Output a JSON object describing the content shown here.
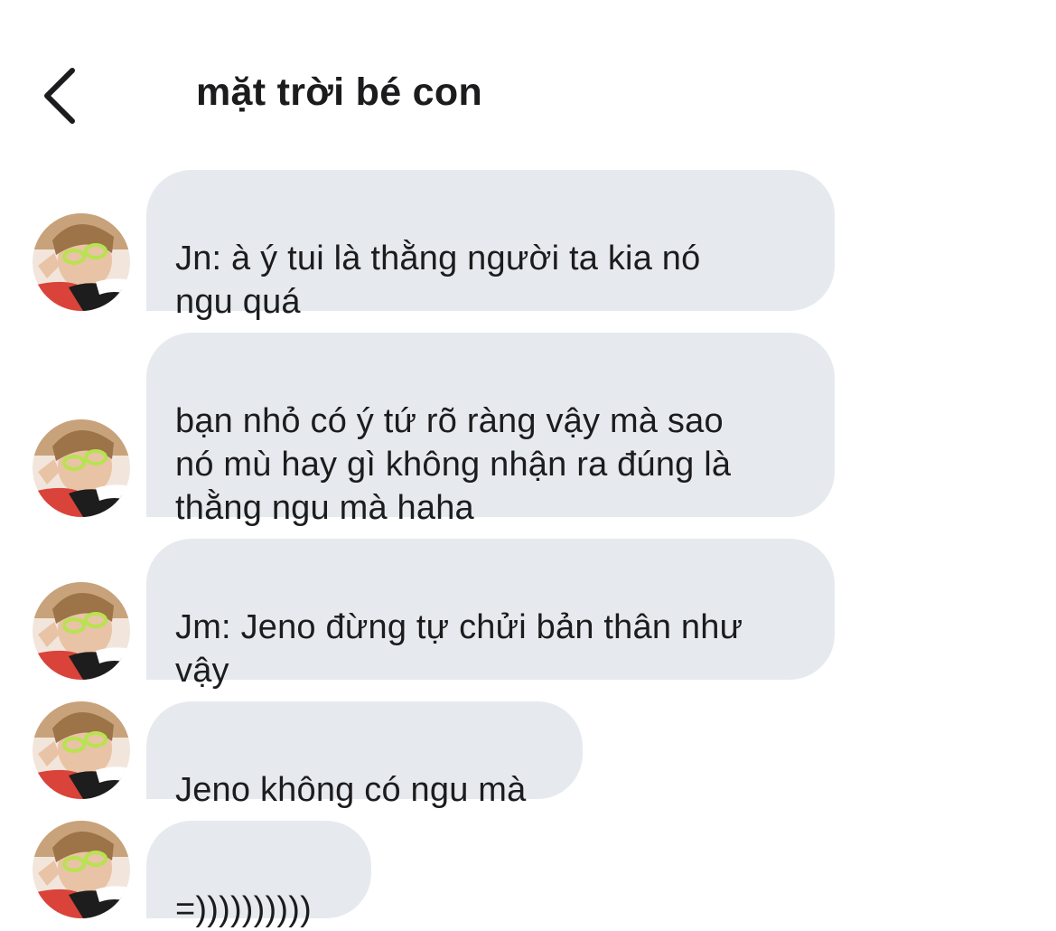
{
  "header": {
    "title": "mặt trời bé con",
    "back_icon": "chevron-left-icon"
  },
  "messages": [
    {
      "text": "Jn: à ý tui là thằng người ta kia nó\nngu quá",
      "avatar_icon": "profile-photo-avatar"
    },
    {
      "text": "bạn nhỏ có ý tứ rõ ràng vậy mà sao\nnó mù hay gì không nhận ra đúng là\nthằng ngu mà haha",
      "avatar_icon": "profile-photo-avatar"
    },
    {
      "text": "Jm: Jeno đừng tự chửi bản thân như\nvậy",
      "avatar_icon": "profile-photo-avatar"
    },
    {
      "text": "Jeno không có ngu mà",
      "avatar_icon": "profile-photo-avatar"
    },
    {
      "text": "=))))))))))",
      "avatar_icon": "profile-photo-avatar"
    }
  ],
  "colors": {
    "bubble_background": "#e6eaee",
    "text": "#1c1c1e",
    "background": "#ffffff"
  }
}
